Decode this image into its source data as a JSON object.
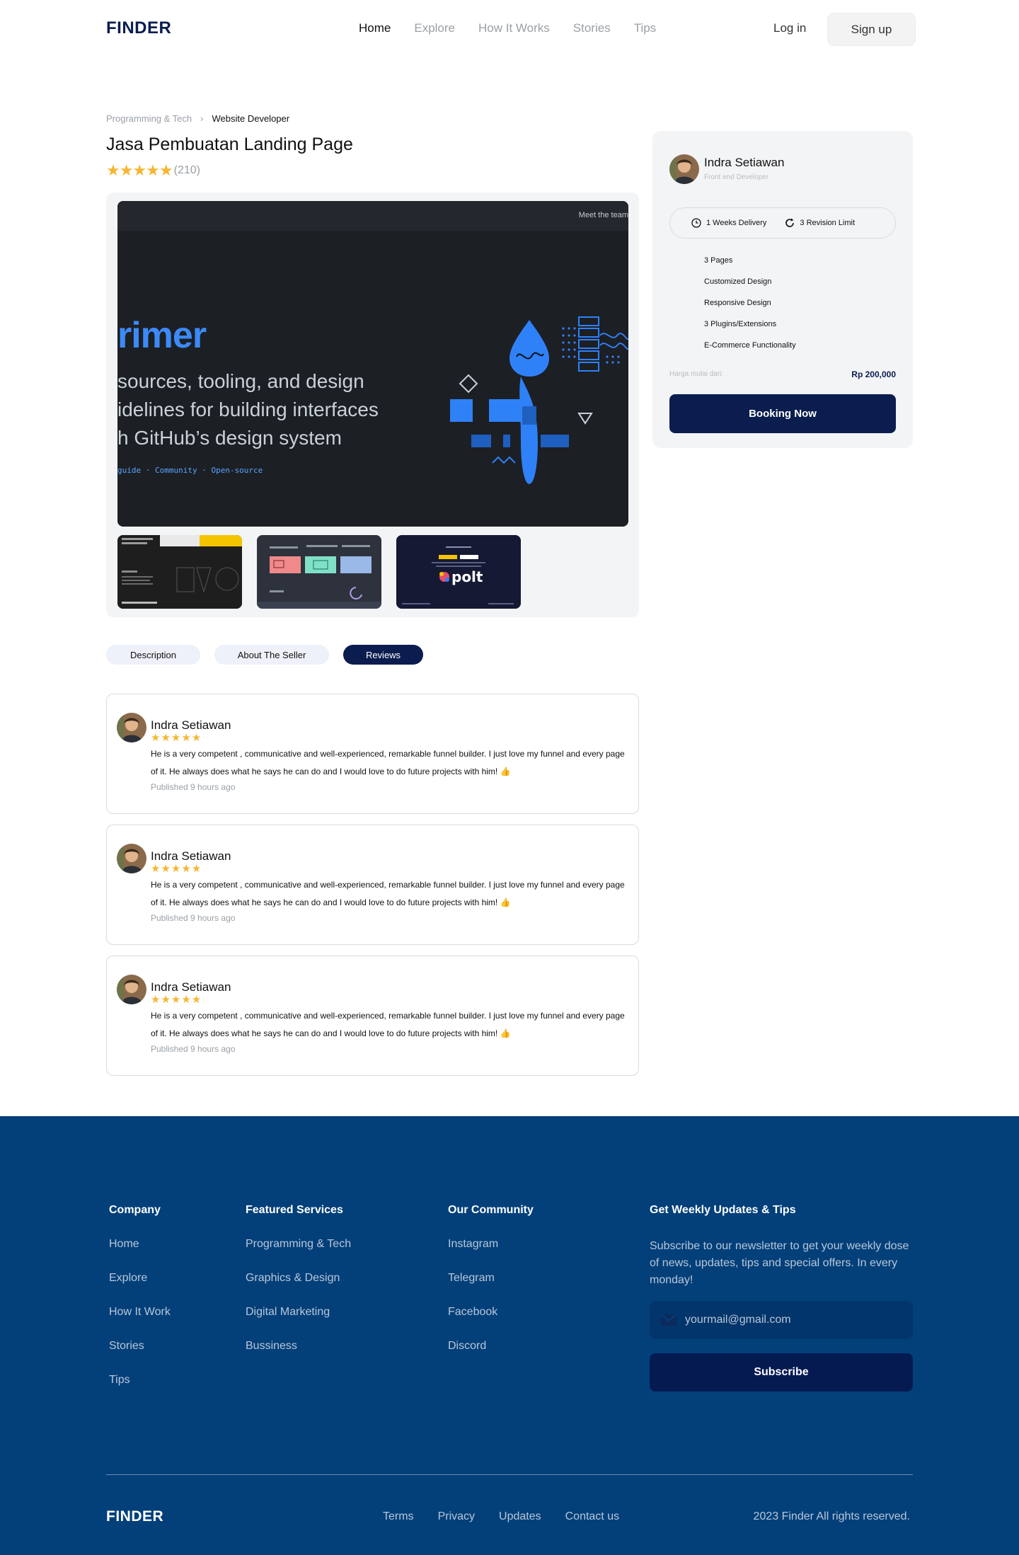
{
  "nav": {
    "logo": "FINDER",
    "links": [
      "Home",
      "Explore",
      "How It Works",
      "Stories",
      "Tips"
    ],
    "login": "Log in",
    "signup": "Sign up"
  },
  "breadcrumb": {
    "category": "Programming & Tech",
    "separator": "›",
    "current": "Website Developer"
  },
  "service": {
    "title": "Jasa Pembuatan Landing Page",
    "stars": "★★★★★",
    "review_count": "(210)"
  },
  "gallery": {
    "main": {
      "meet": "Meet the team",
      "brand": "rimer",
      "tagline_lines": [
        "sources, tooling, and design",
        "idelines for building interfaces",
        "h GitHub’s design system"
      ],
      "links": "guide  ·  Community  ·  Open-source"
    }
  },
  "tabs": [
    "Description",
    "About The Seller",
    "Reviews"
  ],
  "reviews": [
    {
      "name": "Indra Setiawan",
      "stars": "★★★★★",
      "text": "He is a very competent , communicative and well-experienced, remarkable funnel builder. I just love my funnel and every page of it. He always does what he says he can do and I would love to do future projects with him! 👍",
      "date": "Published 9 hours ago"
    },
    {
      "name": "Indra Setiawan",
      "stars": "★★★★★",
      "text": "He is a very competent , communicative and well-experienced, remarkable funnel builder. I just love my funnel and every page of it. He always does what he says he can do and I would love to do future projects with him! 👍",
      "date": "Published 9 hours ago"
    },
    {
      "name": "Indra Setiawan",
      "stars": "★★★★★",
      "text": "He is a very competent , communicative and well-experienced, remarkable funnel builder. I just love my funnel and every page of it. He always does what he says he can do and I would love to do future projects with him! 👍",
      "date": "Published 9 hours ago"
    }
  ],
  "seller": {
    "name": "Indra Setiawan",
    "role": "Front end Developer",
    "delivery": "1 Weeks Delivery",
    "revision": "3 Revision Limit",
    "features": [
      "3 Pages",
      "Customized Design",
      "Responsive Design",
      "3 Plugins/Extensions",
      "E-Commerce Functionality"
    ],
    "price_label": "Harga mulai dari:",
    "price": "Rp 200,000",
    "booking": "Booking Now"
  },
  "footer": {
    "company": {
      "title": "Company",
      "items": [
        "Home",
        "Explore",
        "How It Work",
        "Stories",
        "Tips"
      ]
    },
    "services": {
      "title": "Featured Services",
      "items": [
        "Programming & Tech",
        "Graphics & Design",
        "Digital Marketing",
        "Bussiness"
      ]
    },
    "community": {
      "title": "Our Community",
      "items": [
        "Instagram",
        "Telegram",
        "Facebook",
        "Discord"
      ]
    },
    "newsletter": {
      "title": "Get Weekly  Updates & Tips",
      "desc": "Subscribe to our  newsletter to get your weekly dose of news, updates, tips and special offers. In every monday!",
      "email_placeholder": "yourmail@gmail.com",
      "subscribe": "Subscribe"
    },
    "logo": "FINDER",
    "links": [
      "Terms",
      "Privacy",
      "Updates",
      "Contact us"
    ],
    "copyright": "2023 Finder All rights  reserved."
  },
  "colors": {
    "navy": "#0b1d4f",
    "footer_bg": "#03407a",
    "star": "#f5b631"
  }
}
